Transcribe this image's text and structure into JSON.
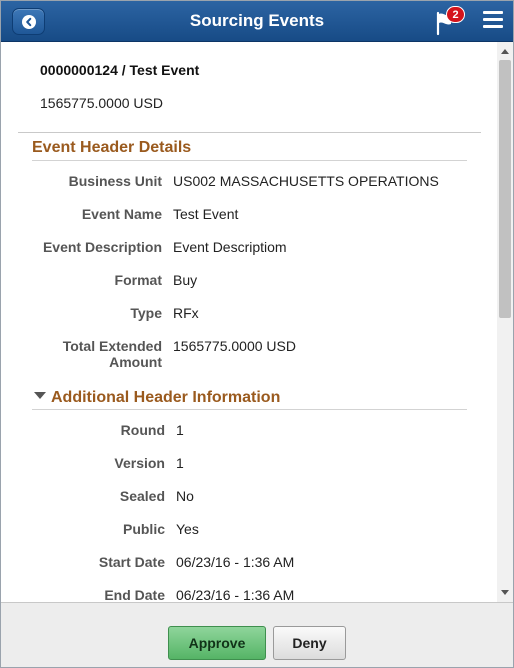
{
  "header": {
    "title": "Sourcing Events",
    "notification_count": "2"
  },
  "summary": {
    "title": "0000000124 / Test Event",
    "amount": "1565775.0000 USD"
  },
  "event_header": {
    "section_title": "Event Header Details",
    "fields": [
      {
        "label": "Business Unit",
        "value": "US002 MASSACHUSETTS OPERATIONS"
      },
      {
        "label": "Event Name",
        "value": "Test Event"
      },
      {
        "label": "Event Description",
        "value": "Event Descriptiom"
      },
      {
        "label": "Format",
        "value": "Buy"
      },
      {
        "label": "Type",
        "value": "RFx"
      },
      {
        "label_line1": "Total Extended",
        "label_line2": "Amount",
        "value": "1565775.0000 USD"
      }
    ]
  },
  "additional_info": {
    "section_title": "Additional Header Information",
    "fields": [
      {
        "label": "Round",
        "value": "1"
      },
      {
        "label": "Version",
        "value": "1"
      },
      {
        "label": "Sealed",
        "value": "No"
      },
      {
        "label": "Public",
        "value": "Yes"
      },
      {
        "label": "Start Date",
        "value": "06/23/16 - 1:36 AM"
      },
      {
        "label": "End Date",
        "value": "06/23/16 - 1:36 AM"
      }
    ]
  },
  "footer": {
    "approve_label": "Approve",
    "deny_label": "Deny"
  },
  "colors": {
    "header_bg": "#1f5797",
    "section_title": "#9a5a1e",
    "approve_bg": "#6cc47b",
    "badge": "#d4141c"
  }
}
